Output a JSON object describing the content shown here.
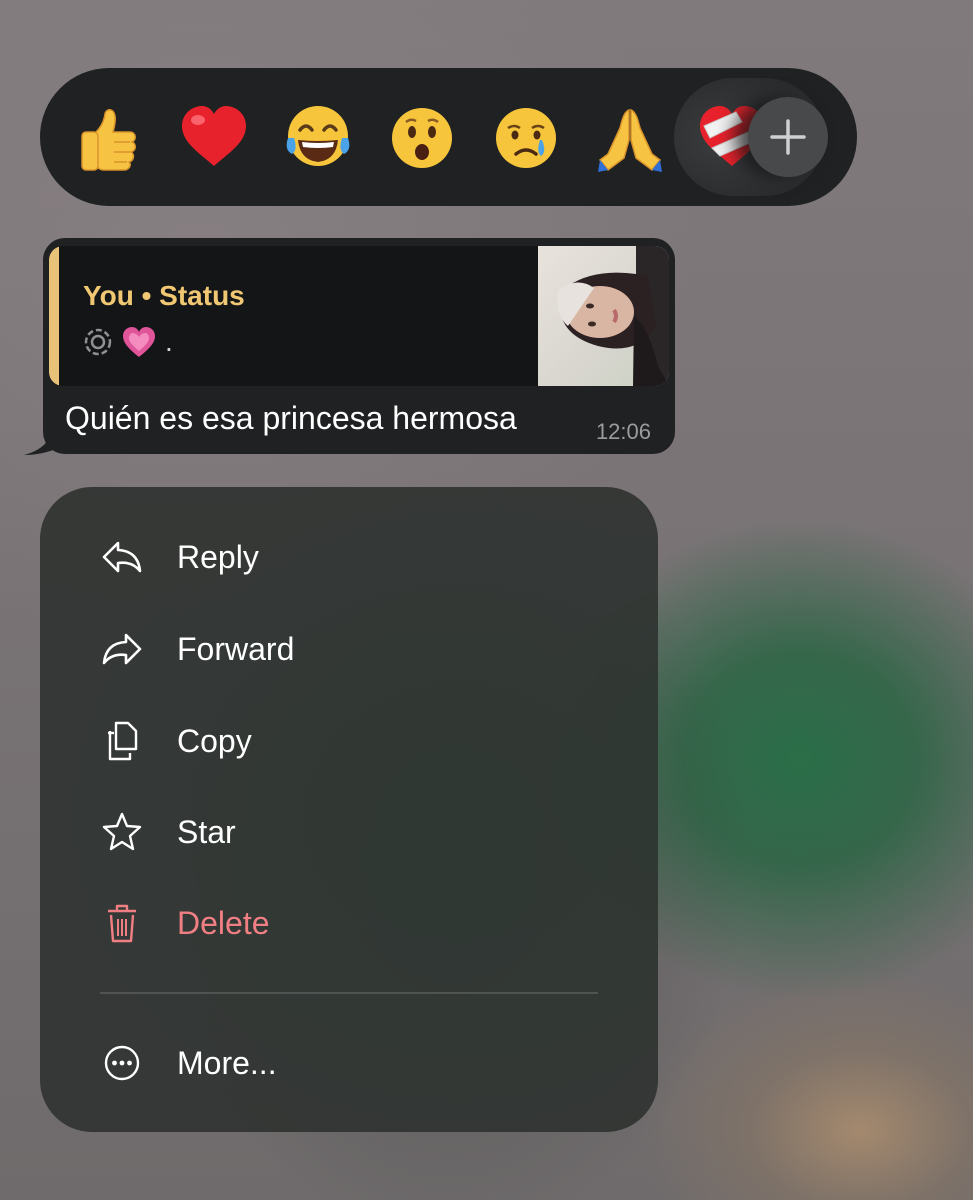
{
  "reactions": {
    "items": [
      {
        "name": "thumbs-up",
        "emoji": "👍"
      },
      {
        "name": "red-heart",
        "emoji": "❤️"
      },
      {
        "name": "tears-of-joy",
        "emoji": "😂"
      },
      {
        "name": "surprised",
        "emoji": "😮"
      },
      {
        "name": "crying",
        "emoji": "😢"
      },
      {
        "name": "folded-hands",
        "emoji": "🙏"
      },
      {
        "name": "mending-heart",
        "emoji": "❤️‍🩹"
      }
    ],
    "add_icon": "plus-icon"
  },
  "message": {
    "quote": {
      "title": "You • Status",
      "status_icon": "status-ring-icon",
      "body_emoji": "💗",
      "body_text": "."
    },
    "text": "Quién es esa princesa hermosa",
    "time": "12:06"
  },
  "menu": {
    "items": [
      {
        "label": "Reply",
        "icon": "reply-icon"
      },
      {
        "label": "Forward",
        "icon": "forward-icon"
      },
      {
        "label": "Copy",
        "icon": "copy-icon"
      },
      {
        "label": "Star",
        "icon": "star-icon"
      },
      {
        "label": "Delete",
        "icon": "trash-icon",
        "danger": true
      },
      {
        "label": "More...",
        "icon": "more-icon"
      }
    ]
  },
  "colors": {
    "quote_accent": "#f0c874",
    "danger": "#f07f84",
    "bubble": "#1f2122"
  }
}
